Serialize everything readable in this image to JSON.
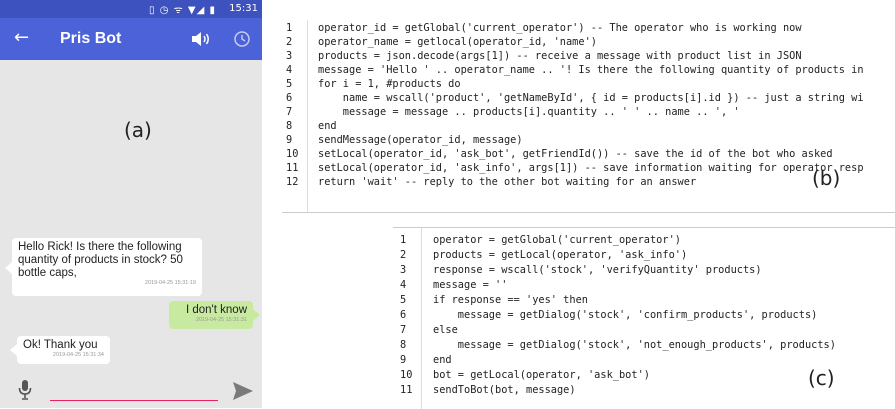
{
  "phone": {
    "status_time": "15:31",
    "status_icons": "▯ ◷ ᯤ ▼◢ ▮",
    "back_icon": "arrow-left",
    "title": "Pris Bot",
    "speaker_icon": "speaker",
    "clock_icon": "clock",
    "panel_label": "(a)",
    "messages": [
      {
        "text": "Hello Rick! Is there the following quantity of products in stock? 50 bottle caps,",
        "timestamp": "2019-04-25 15:31:19",
        "side": "left"
      },
      {
        "text": "I don't know",
        "timestamp": "2019-04-25 15:31:31",
        "side": "right"
      },
      {
        "text": "Ok! Thank you",
        "timestamp": "2019-04-25 15:31:34",
        "side": "left"
      }
    ],
    "input_value": "",
    "mic_icon": "microphone",
    "send_icon": "send",
    "colors": {
      "status_bar": "#3e52bf",
      "app_bar": "#4b62d8",
      "background": "#e6e6e6",
      "outgoing_bubble": "#c8eaa0",
      "input_underline": "#e91e63"
    }
  },
  "code_b": {
    "label": "(b)",
    "lines": [
      {
        "n": "1",
        "code": "operator_id = getGlobal('current_operator') -- The operator who is working now"
      },
      {
        "n": "2",
        "code": "operator_name = getlocal(operator_id, 'name')"
      },
      {
        "n": "3",
        "code": "products = json.decode(args[1]) -- receive a message with product list in JSON"
      },
      {
        "n": "4",
        "code": "message = 'Hello ' .. operator_name .. '! Is there the following quantity of products in"
      },
      {
        "n": "5",
        "code": "for i = 1, #products do"
      },
      {
        "n": "6",
        "code": "    name = wscall('product', 'getNameById', { id = products[i].id }) -- just a string wi"
      },
      {
        "n": "7",
        "code": "    message = message .. products[i].quantity .. ' ' .. name .. ', '"
      },
      {
        "n": "8",
        "code": "end"
      },
      {
        "n": "9",
        "code": "sendMessage(operator_id, message)"
      },
      {
        "n": "10",
        "code": "setLocal(operator_id, 'ask_bot', getFriendId()) -- save the id of the bot who asked"
      },
      {
        "n": "11",
        "code": "setLocal(operator_id, 'ask_info', args[1]) -- save information waiting for operator resp"
      },
      {
        "n": "12",
        "code": "return 'wait' -- reply to the other bot waiting for an answer"
      }
    ]
  },
  "code_c": {
    "label": "(c)",
    "lines": [
      {
        "n": "1",
        "code": "operator = getGlobal('current_operator')"
      },
      {
        "n": "2",
        "code": "products = getLocal(operator, 'ask_info')"
      },
      {
        "n": "3",
        "code": "response = wscall('stock', 'verifyQuantity' products)"
      },
      {
        "n": "4",
        "code": "message = ''"
      },
      {
        "n": "5",
        "code": "if response == 'yes' then"
      },
      {
        "n": "6",
        "code": "    message = getDialog('stock', 'confirm_products', products)"
      },
      {
        "n": "7",
        "code": "else"
      },
      {
        "n": "8",
        "code": "    message = getDialog('stock', 'not_enough_products', products)"
      },
      {
        "n": "9",
        "code": "end"
      },
      {
        "n": "10",
        "code": "bot = getLocal(operator, 'ask_bot')"
      },
      {
        "n": "11",
        "code": "sendToBot(bot, message)"
      }
    ]
  }
}
